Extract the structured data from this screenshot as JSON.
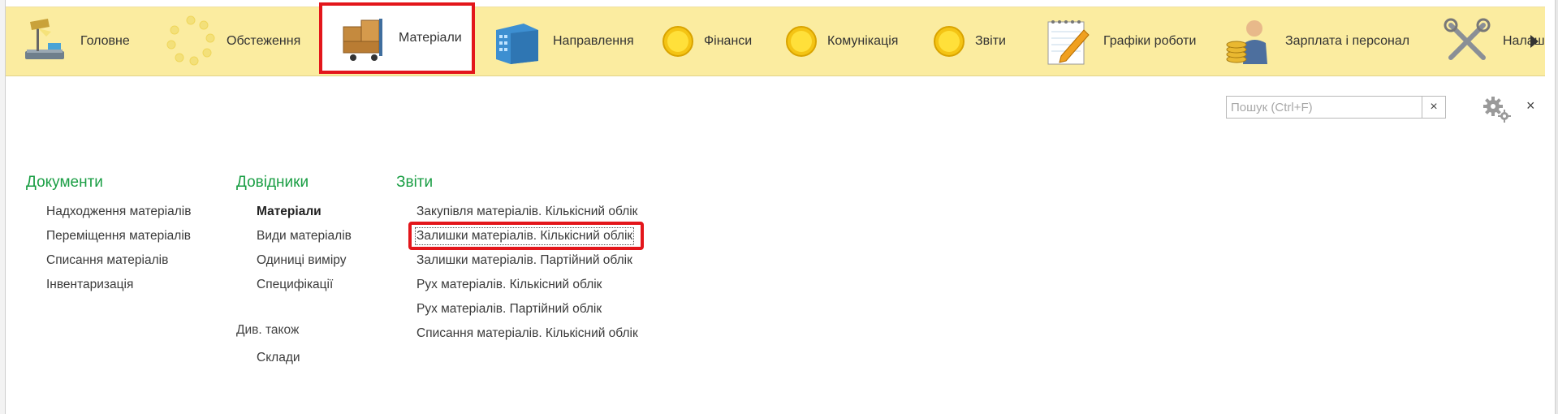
{
  "sections": [
    {
      "label": "Головне",
      "icon": "desk-lamp-icon"
    },
    {
      "label": "Обстеження",
      "icon": "loading-spinner-icon"
    },
    {
      "label": "Матеріали",
      "icon": "boxes-cart-icon"
    },
    {
      "label": "Направлення",
      "icon": "building-icon"
    },
    {
      "label": "Фінанси",
      "icon": "yellow-circle-icon"
    },
    {
      "label": "Комунікація",
      "icon": "yellow-circle-icon"
    },
    {
      "label": "Звіти",
      "icon": "yellow-circle-icon"
    },
    {
      "label": "Графіки роботи",
      "icon": "notepad-pencil-icon"
    },
    {
      "label": "Зарплата і персонал",
      "icon": "worker-coins-icon"
    },
    {
      "label": "Налаш",
      "icon": "tools-icon"
    }
  ],
  "search": {
    "placeholder": "Пошук (Ctrl+F)",
    "value": "",
    "clear_glyph": "×"
  },
  "close_glyph": "×",
  "panel": {
    "documents": {
      "title": "Документи",
      "items": [
        "Надходження матеріалів",
        "Переміщення матеріалів",
        "Списання матеріалів",
        "Інвентаризація"
      ]
    },
    "catalogs": {
      "title": "Довідники",
      "items": [
        "Матеріали",
        "Види матеріалів",
        "Одиниці виміру",
        "Специфікації"
      ],
      "see_also": "Див. також",
      "see_also_items": [
        "Склади"
      ]
    },
    "reports": {
      "title": "Звіти",
      "items": [
        "Закупівля матеріалів. Кількісний облік",
        "Залишки матеріалів. Кількісний облік",
        "Залишки матеріалів. Партійний облік",
        "Рух матеріалів. Кількісний облік",
        "Рух матеріалів. Партійний облік",
        "Списання матеріалів. Кількісний облік"
      ]
    }
  },
  "colors": {
    "accent_green": "#1a9e44",
    "topbar_bg": "#fbeca0",
    "highlight_red": "#e3161b"
  }
}
